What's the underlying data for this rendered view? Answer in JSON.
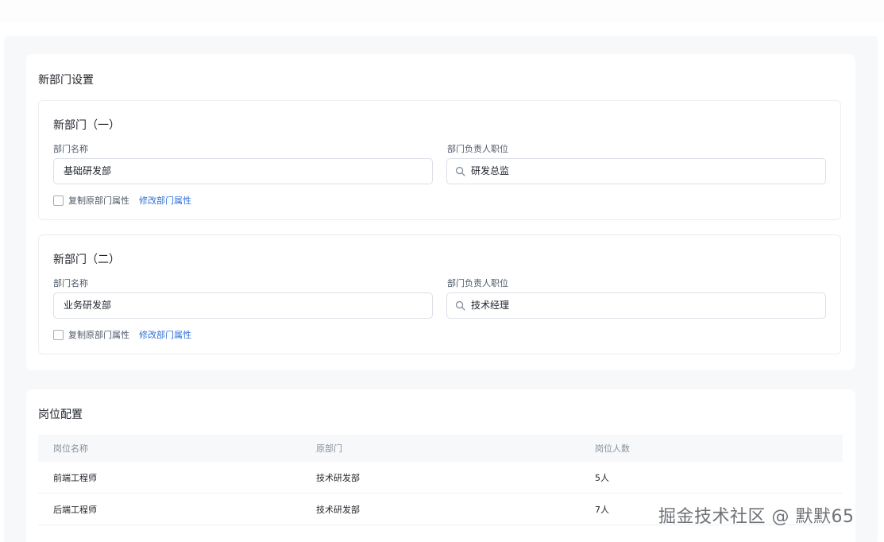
{
  "settings": {
    "title": "新部门设置",
    "departments": [
      {
        "title": "新部门（一）",
        "name_label": "部门名称",
        "name_value": "基础研发部",
        "leader_label": "部门负责人职位",
        "leader_value": "研发总监",
        "copy_label": "复制原部门属性",
        "modify_link": "修改部门属性"
      },
      {
        "title": "新部门（二）",
        "name_label": "部门名称",
        "name_value": "业务研发部",
        "leader_label": "部门负责人职位",
        "leader_value": "技术经理",
        "copy_label": "复制原部门属性",
        "modify_link": "修改部门属性"
      }
    ]
  },
  "positions": {
    "title": "岗位配置",
    "headers": [
      "岗位名称",
      "原部门",
      "岗位人数"
    ],
    "rows": [
      [
        "前端工程师",
        "技术研发部",
        "5人"
      ],
      [
        "后端工程师",
        "技术研发部",
        "7人"
      ]
    ]
  },
  "watermark": "掘金技术社区 @ 默默65",
  "colors": {
    "link": "#2f6fd6",
    "border": "#dcdfe6",
    "background": "#f7f8fa"
  }
}
